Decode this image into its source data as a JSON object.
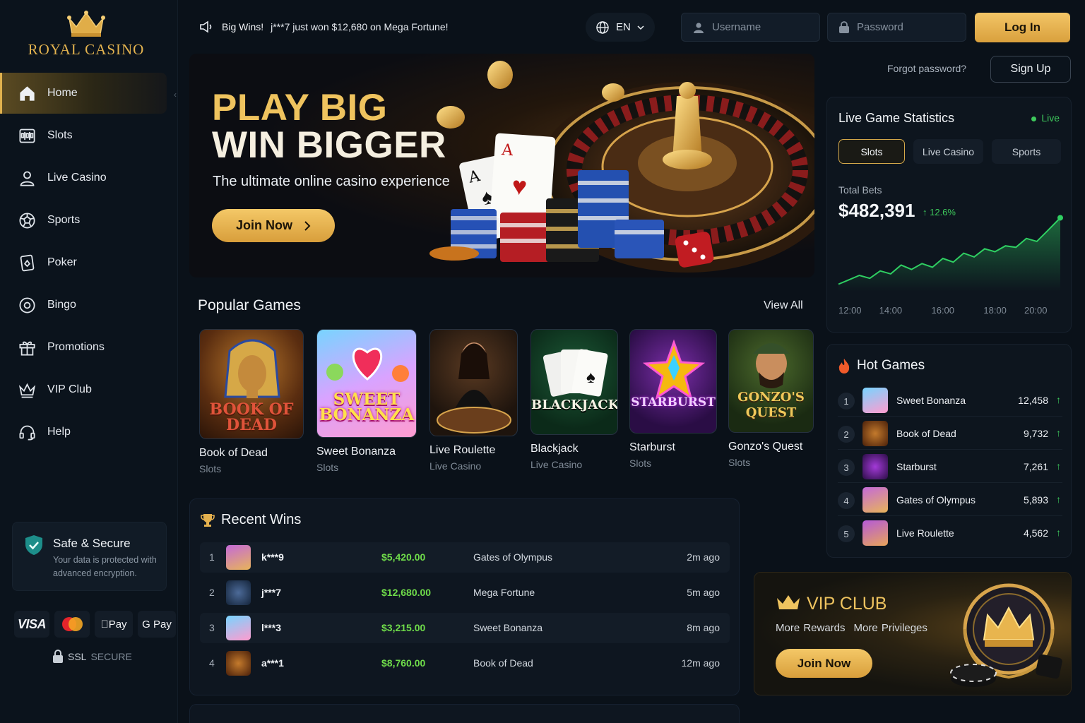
{
  "brand": {
    "name": "ROYAL CASINO"
  },
  "nav": [
    {
      "label": "Home",
      "icon": "home-icon",
      "active": true
    },
    {
      "label": "Slots",
      "icon": "slots-icon"
    },
    {
      "label": "Live Casino",
      "icon": "user-icon"
    },
    {
      "label": "Sports",
      "icon": "soccer-ball-icon"
    },
    {
      "label": "Poker",
      "icon": "cards-icon"
    },
    {
      "label": "Bingo",
      "icon": "bingo-icon"
    },
    {
      "label": "Promotions",
      "icon": "gift-icon"
    },
    {
      "label": "VIP Club",
      "icon": "crown-icon"
    },
    {
      "label": "Help",
      "icon": "headset-icon"
    }
  ],
  "secure": {
    "title": "Safe & Secure",
    "desc": "Your data is protected with advanced encryption."
  },
  "payments": [
    "VISA",
    "Pay",
    "G Pay"
  ],
  "ssl": {
    "a": "SSL",
    "b": "SECURE"
  },
  "ticker": {
    "lead": "Big Wins!",
    "text": "j***7 just won $12,680 on Mega Fortune!"
  },
  "lang": "EN",
  "login": {
    "username_placeholder": "Username",
    "password_placeholder": "Password",
    "button": "Log In",
    "forgot": "Forgot password?",
    "signup": "Sign Up"
  },
  "hero": {
    "line1": "PLAY BIG",
    "line2": "WIN BIGGER",
    "subtitle": "The ultimate online casino experience",
    "cta": "Join Now"
  },
  "popular": {
    "title": "Popular Games",
    "view_all": "View All",
    "games": [
      {
        "name": "Book of Dead",
        "category": "Slots",
        "art": "BOOK OF DEAD"
      },
      {
        "name": "Sweet Bonanza",
        "category": "Slots",
        "art": "SWEET BONANZA"
      },
      {
        "name": "Live Roulette",
        "category": "Live Casino",
        "art": ""
      },
      {
        "name": "Blackjack",
        "category": "Live Casino",
        "art": "BLACKJACK"
      },
      {
        "name": "Starburst",
        "category": "Slots",
        "art": "STARBURST"
      },
      {
        "name": "Gonzo's Quest",
        "category": "Slots",
        "art": "GONZO'S QUEST"
      }
    ]
  },
  "recent_wins": {
    "title": "Recent Wins",
    "rows": [
      {
        "rank": "1",
        "user": "k***9",
        "amount": "$5,420.00",
        "game": "Gates of Olympus",
        "time": "2m ago"
      },
      {
        "rank": "2",
        "user": "j***7",
        "amount": "$12,680.00",
        "game": "Mega Fortune",
        "time": "5m ago"
      },
      {
        "rank": "3",
        "user": "l***3",
        "amount": "$3,215.00",
        "game": "Sweet Bonanza",
        "time": "8m ago"
      },
      {
        "rank": "4",
        "user": "a***1",
        "amount": "$8,760.00",
        "game": "Book of Dead",
        "time": "12m ago"
      }
    ]
  },
  "stats": {
    "title": "Live Game Statistics",
    "live": "Live",
    "tabs": [
      "Slots",
      "Live Casino",
      "Sports"
    ],
    "total_label": "Total Bets",
    "total_value": "$482,391",
    "change": "↑ 12.6%",
    "colors": {
      "line": "#2fcf62"
    }
  },
  "chart_data": {
    "type": "line",
    "x_ticks": [
      "12:00",
      "14:00",
      "16:00",
      "18:00",
      "20:00"
    ],
    "x": [
      12,
      12.4,
      12.8,
      13.2,
      13.6,
      14.0,
      14.4,
      14.8,
      15.2,
      15.6,
      16.0,
      16.4,
      16.8,
      17.2,
      17.6,
      18.0,
      18.4,
      18.8,
      19.2,
      19.6,
      20.0,
      20.5
    ],
    "values": [
      10,
      16,
      22,
      18,
      28,
      24,
      36,
      30,
      38,
      33,
      45,
      40,
      52,
      47,
      58,
      54,
      62,
      60,
      72,
      68,
      82,
      100
    ],
    "ylim": [
      0,
      110
    ],
    "grid": false
  },
  "hot": {
    "title": "Hot Games",
    "rows": [
      {
        "rank": "1",
        "name": "Sweet Bonanza",
        "count": "12,458",
        "up": "↑"
      },
      {
        "rank": "2",
        "name": "Book of Dead",
        "count": "9,732",
        "up": "↑"
      },
      {
        "rank": "3",
        "name": "Starburst",
        "count": "7,261",
        "up": "↑"
      },
      {
        "rank": "4",
        "name": "Gates of Olympus",
        "count": "5,893",
        "up": "↑"
      },
      {
        "rank": "5",
        "name": "Live Roulette",
        "count": "4,562",
        "up": "↑"
      }
    ]
  },
  "vip": {
    "title": "VIP CLUB",
    "sub1": "More Rewards",
    "sub2": "More Privileges",
    "cta": "Join Now"
  }
}
